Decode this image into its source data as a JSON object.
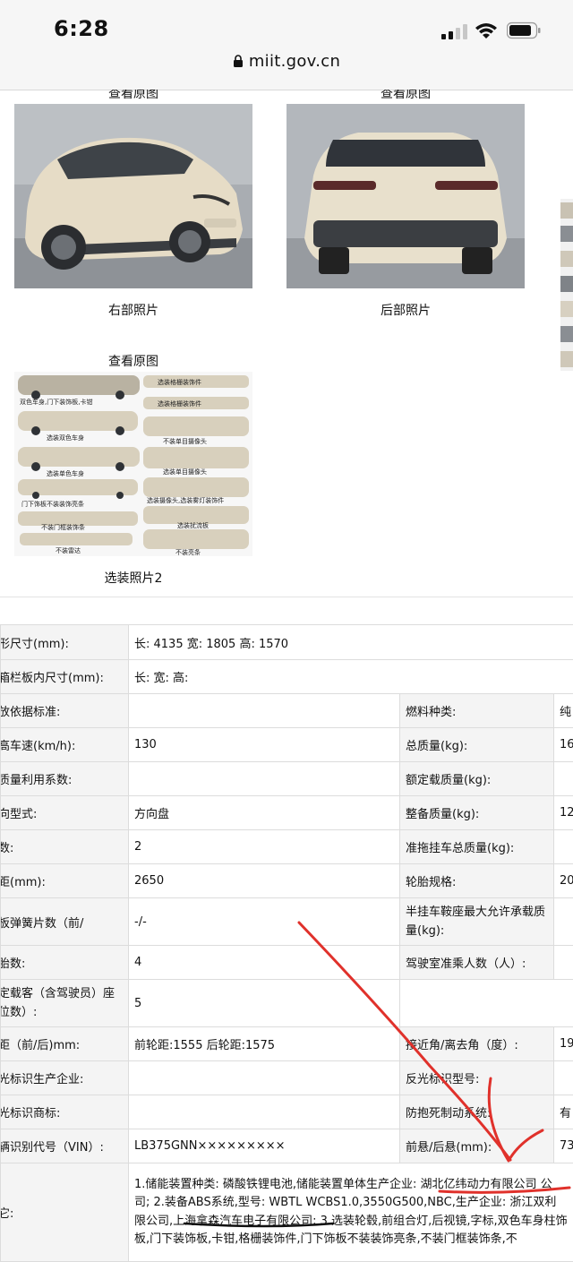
{
  "status_bar": {
    "time": "6:28",
    "url": "miit.gov.cn"
  },
  "gallery": {
    "row1": [
      {
        "view_label": "查看原图",
        "caption": "右部照片"
      },
      {
        "view_label": "查看原图",
        "caption": "后部照片"
      }
    ],
    "row2": [
      {
        "view_label": "查看原图",
        "caption": "选装照片2"
      }
    ],
    "collage_labels": [
      "双色车身,门下装饰板,卡钳",
      "选装格栅装饰件",
      "选装格栅装饰件",
      "选装双色车身",
      "不装单目摄像头",
      "选装单色车身",
      "选装单目摄像头",
      "选装摄像头,选装雾灯装饰件",
      "门下饰板不装装饰亮条",
      "选装扰流板",
      "不装门框装饰条",
      "不装雷达",
      "不装亮条"
    ]
  },
  "specs": {
    "rows": [
      {
        "l1": "形尺寸(mm):",
        "v1": "长: 4135 宽: 1805 高: 1570",
        "span": true
      },
      {
        "l1": "箱栏板内尺寸(mm):",
        "v1": "长:  宽:  高:",
        "span": true
      },
      {
        "l1": "放依据标准:",
        "v1": "",
        "l2": "燃料种类:",
        "v2": "纯"
      },
      {
        "l1": "高车速(km/h):",
        "v1": "130",
        "l2": "总质量(kg):",
        "v2": "16"
      },
      {
        "l1": "质量利用系数:",
        "v1": "",
        "l2": "额定载质量(kg):",
        "v2": ""
      },
      {
        "l1": "向型式:",
        "v1": "方向盘",
        "l2": "整备质量(kg):",
        "v2": "12"
      },
      {
        "l1": "数:",
        "v1": "2",
        "l2": "准拖挂车总质量(kg):",
        "v2": ""
      },
      {
        "l1": "距(mm):",
        "v1": "2650",
        "l2": "轮胎规格:",
        "v2": "20"
      },
      {
        "l1": "板弹簧片数（前/",
        "v1": "-/-",
        "l2": "半挂车鞍座最大允许承载质量(kg):",
        "v2": ""
      },
      {
        "l1": "胎数:",
        "v1": "4",
        "l2": "驾驶室准乘人数（人）:",
        "v2": ""
      },
      {
        "l1": "定载客（含驾驶员）座位数）:",
        "v1": "5",
        "l2": "",
        "v2": "",
        "span": true
      },
      {
        "l1": "距（前/后)mm:",
        "v1": "前轮距:1555 后轮距:1575",
        "l2": "接近角/离去角（度）:",
        "v2": "19/"
      },
      {
        "l1": "光标识生产企业:",
        "v1": "",
        "l2": "反光标识型号:",
        "v2": ""
      },
      {
        "l1": "光标识商标:",
        "v1": "",
        "l2": "防抱死制动系统:",
        "v2": "有"
      },
      {
        "l1": "辆识别代号（VIN）:",
        "v1": "LB375GNN×××××××××",
        "l2": "前悬/后悬(mm):",
        "v2": "73"
      }
    ],
    "note_label": "它:",
    "note_text": "1.储能装置种类: 磷酸铁锂电池,储能装置单体生产企业: 湖北亿纬动力有限公司 公司; 2.装备ABS系统,型号: WBTL WCBS1.0,3550G500,NBC,生产企业: 浙江双利限公司,上海拿森汽车电子有限公司; 3.选装轮毂,前组合灯,后视镜,字标,双色车身柱饰板,门下装饰板,卡钳,格栅装饰件,门下饰板不装装饰亮条,不装门框装饰条,不"
  },
  "colors": {
    "annotation": "#e0312b",
    "table_border": "#dcdcdc",
    "label_bg": "#f4f4f4"
  }
}
